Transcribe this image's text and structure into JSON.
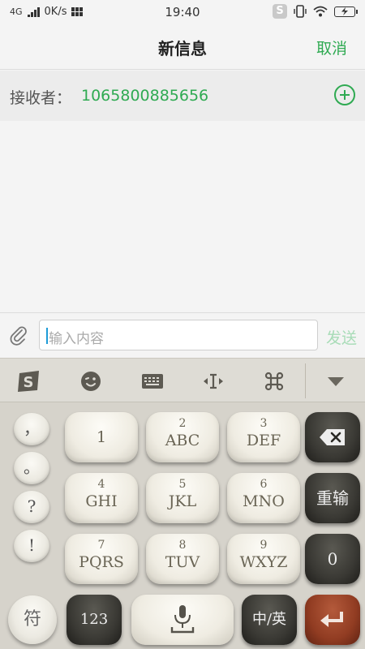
{
  "status_bar": {
    "network": "4G",
    "speed": "0K/s",
    "time": "19:40"
  },
  "header": {
    "title": "新信息",
    "cancel_label": "取消"
  },
  "recipient": {
    "label": "接收者：",
    "number": "1065800885656"
  },
  "composer": {
    "placeholder": "输入内容",
    "send_label": "发送"
  },
  "keyboard": {
    "toolbar": {
      "items": [
        "sogou-logo-icon",
        "emoji-icon",
        "keyboard-icon",
        "cursor-move-icon",
        "command-icon",
        "collapse-icon"
      ]
    },
    "punctuation": [
      "，",
      "。",
      "?",
      "!"
    ],
    "keys": [
      {
        "num": "",
        "letters": "1"
      },
      {
        "num": "2",
        "letters": "ABC"
      },
      {
        "num": "3",
        "letters": "DEF"
      },
      {
        "num": "4",
        "letters": "GHI"
      },
      {
        "num": "5",
        "letters": "JKL"
      },
      {
        "num": "6",
        "letters": "MNO"
      },
      {
        "num": "7",
        "letters": "PQRS"
      },
      {
        "num": "8",
        "letters": "TUV"
      },
      {
        "num": "9",
        "letters": "WXYZ"
      }
    ],
    "reinput_label": "重输",
    "zero_label": "0",
    "symbols_label": "符",
    "numbers_label": "123",
    "lang_label": "中/英"
  },
  "colors": {
    "accent_green": "#2faa52",
    "send_disabled": "#a8dcb7",
    "enter_key": "#913c22"
  }
}
